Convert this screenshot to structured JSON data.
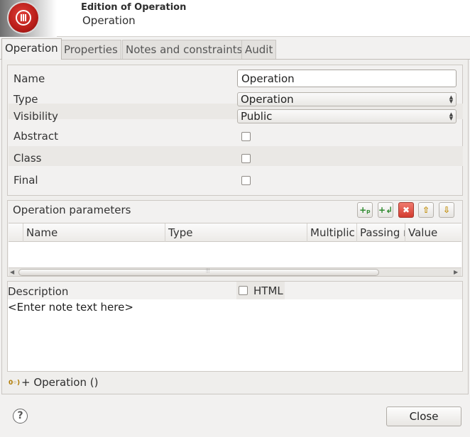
{
  "header": {
    "title": "Edition of Operation",
    "subtitle": "Operation"
  },
  "tabs": [
    {
      "label": "Operation",
      "active": true
    },
    {
      "label": "Properties",
      "active": false
    },
    {
      "label": "Notes and constraints",
      "active": false
    },
    {
      "label": "Audit",
      "active": false
    }
  ],
  "fields": {
    "name_label": "Name",
    "name_value": "Operation",
    "type_label": "Type",
    "type_value": "Operation",
    "visibility_label": "Visibility",
    "visibility_value": "Public",
    "abstract_label": "Abstract",
    "abstract_checked": false,
    "class_label": "Class",
    "class_checked": false,
    "final_label": "Final",
    "final_checked": false
  },
  "parameters": {
    "title": "Operation parameters",
    "columns": [
      "Name",
      "Type",
      "Multiplic",
      "Passing r",
      "Value"
    ],
    "rows": [],
    "toolbar_icons": [
      "add-parameter-icon",
      "add-return-icon",
      "delete-icon",
      "move-up-icon",
      "move-down-icon"
    ]
  },
  "description": {
    "label": "Description",
    "html_label": "HTML",
    "html_checked": false,
    "placeholder": "<Enter note text here>"
  },
  "signature": "+ Operation ()",
  "footer": {
    "help_glyph": "?",
    "close_label": "Close"
  },
  "colors": {
    "logo_red": "#c8201a",
    "delete_button": "#d33b2f",
    "window_bg": "#f2f1f0"
  }
}
